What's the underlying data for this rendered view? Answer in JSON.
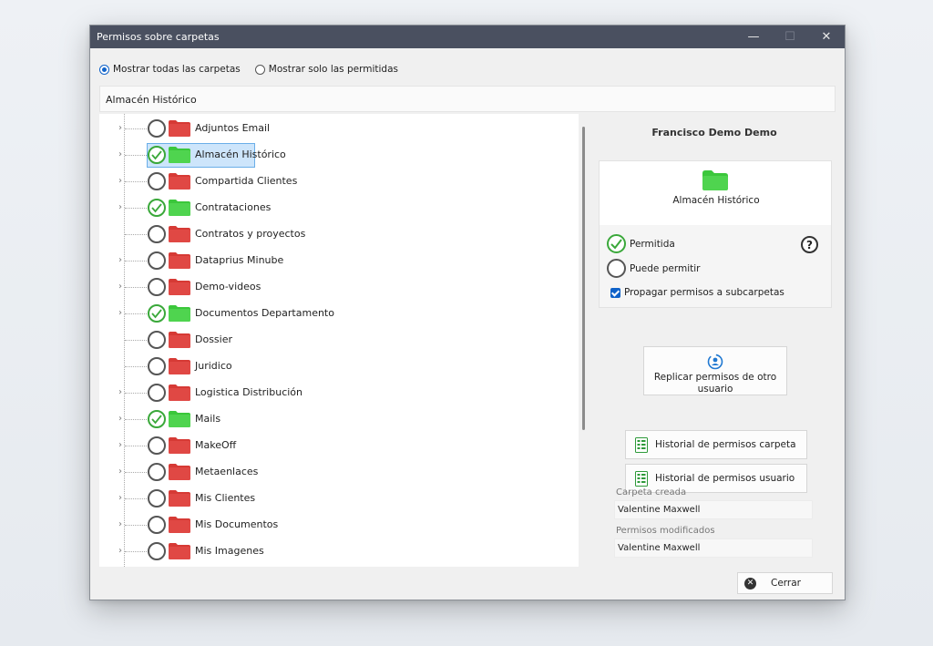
{
  "window": {
    "title": "Permisos sobre carpetas",
    "controls": {
      "minimize": "—",
      "maximize": "☐",
      "close": "✕"
    }
  },
  "filter": {
    "show_all": "Mostrar todas las carpetas",
    "show_allowed": "Mostrar solo las permitidas",
    "selected": "show_all"
  },
  "path": "Almacén Histórico",
  "tree": {
    "selected_item": "Almacén Histórico",
    "items": [
      {
        "label": "Adjuntos Email",
        "allowed": false
      },
      {
        "label": "Almacén Histórico",
        "allowed": true
      },
      {
        "label": "Compartida Clientes",
        "allowed": false
      },
      {
        "label": "Contrataciones",
        "allowed": true
      },
      {
        "label": "Contratos y proyectos",
        "allowed": false
      },
      {
        "label": "Dataprius Minube",
        "allowed": false
      },
      {
        "label": "Demo-videos",
        "allowed": false
      },
      {
        "label": "Documentos Departamento",
        "allowed": true
      },
      {
        "label": "Dossier",
        "allowed": false
      },
      {
        "label": "Juridico",
        "allowed": false
      },
      {
        "label": "Logistica Distribución",
        "allowed": false
      },
      {
        "label": "Mails",
        "allowed": true
      },
      {
        "label": "MakeOff",
        "allowed": false
      },
      {
        "label": "Metaenlaces",
        "allowed": false
      },
      {
        "label": "Mis Clientes",
        "allowed": false
      },
      {
        "label": "Mis Documentos",
        "allowed": false
      },
      {
        "label": "Mis Imagenes",
        "allowed": false
      }
    ]
  },
  "side": {
    "user_name": "Francisco Demo Demo",
    "folder_name": "Almacén Histórico",
    "permitted_label": "Permitida",
    "can_permit_label": "Puede permitir",
    "propagate_label": "Propagar permisos a subcarpetas",
    "help": "?",
    "replicate_button": "Replicar permisos de otro usuario",
    "history_folder_button": "Historial de permisos carpeta",
    "history_user_button": "Historial de permisos usuario",
    "created_label": "Carpeta creada",
    "created_value": "Valentine Maxwell",
    "modified_label": "Permisos modificados",
    "modified_value": "Valentine Maxwell"
  },
  "close_button": "Cerrar",
  "colors": {
    "allowed_folder": "#3bc73b",
    "denied_folder": "#d63a35",
    "check_green": "#3aa83a",
    "accent_blue": "#0f62c9",
    "title_bar": "#4a5060"
  }
}
